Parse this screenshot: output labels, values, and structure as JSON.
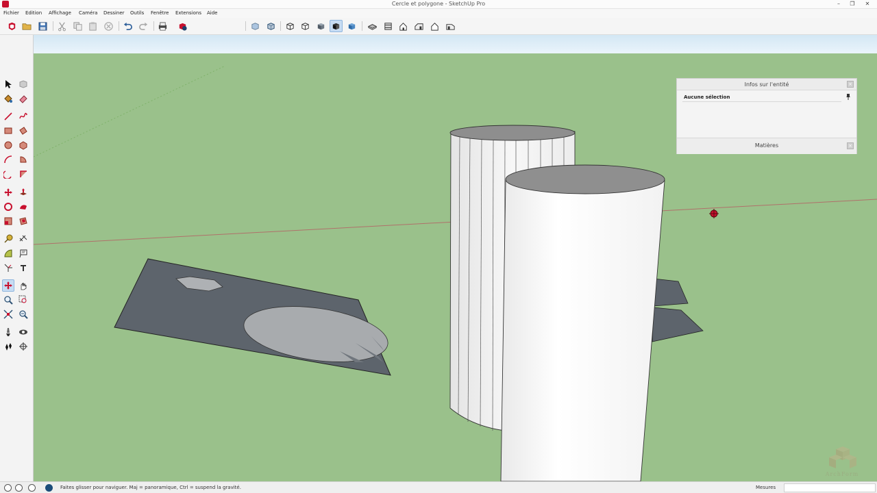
{
  "window": {
    "title": "Cercle et polygone - SketchUp Pro",
    "controls": [
      "–",
      "❐",
      "✕"
    ]
  },
  "menu": [
    "Fichier",
    "Edition",
    "Affichage",
    "Caméra",
    "Dessiner",
    "Outils",
    "Fenêtre",
    "Extensions",
    "Aide"
  ],
  "toolbar": {
    "buttons": [
      {
        "icon": "sketchup-logo-icon"
      },
      {
        "icon": "open-icon"
      },
      {
        "icon": "save-icon"
      },
      {
        "icon": "cut-icon"
      },
      {
        "icon": "copy-icon"
      },
      {
        "icon": "paste-icon"
      },
      {
        "icon": "erase-icon"
      },
      {
        "icon": "undo-icon"
      },
      {
        "icon": "redo-icon"
      },
      {
        "icon": "print-icon"
      },
      {
        "icon": "model-info-icon"
      },
      {
        "icon": "xray-icon"
      },
      {
        "icon": "back-edges-icon"
      },
      {
        "icon": "wireframe-icon"
      },
      {
        "icon": "hidden-line-icon"
      },
      {
        "icon": "shaded-icon"
      },
      {
        "icon": "shaded-textures-icon",
        "active": true
      },
      {
        "icon": "monochrome-icon"
      },
      {
        "icon": "iso-view-icon"
      },
      {
        "icon": "top-view-icon"
      },
      {
        "icon": "front-view-icon"
      },
      {
        "icon": "right-view-icon"
      },
      {
        "icon": "back-view-icon"
      },
      {
        "icon": "left-view-icon"
      }
    ]
  },
  "palette": {
    "tools": [
      "select-icon",
      "component-icon",
      "paint-bucket-icon",
      "eraser-icon",
      "line-icon",
      "freehand-icon",
      "rectangle-icon",
      "rotated-rectangle-icon",
      "circle-icon",
      "polygon-icon",
      "arc-icon",
      "pie-icon",
      "two-point-arc-icon",
      "three-point-arc-icon",
      "move-icon",
      "push-pull-icon",
      "rotate-icon",
      "follow-me-icon",
      "scale-icon",
      "offset-icon",
      "tape-measure-icon",
      "dimension-icon",
      "protractor-icon",
      "text-icon",
      "axes-icon",
      "3d-text-icon",
      "orbit-icon",
      "pan-icon",
      "zoom-icon",
      "zoom-window-icon",
      "zoom-extents-icon",
      "previous-icon",
      "position-camera-icon",
      "look-around-icon",
      "walk-icon",
      "section-plane-icon"
    ],
    "active_tool": "orbit-icon"
  },
  "entity_panel": {
    "title": "Infos sur l'entité",
    "selection": "Aucune sélection",
    "materials_tab": "Matières"
  },
  "status": {
    "hint": "Faites glisser pour naviguer. Maj = panoramique, Ctrl = suspend la gravité.",
    "measure_label": "Mesures",
    "measure_value": ""
  },
  "watermark": {
    "text": "ArchForm"
  },
  "colors": {
    "sky": "#d6e9f5",
    "ground": "#9ac18b",
    "face_dark": "#5d646c",
    "face_light": "#ffffff",
    "selection_blue": "#c7dcf3"
  }
}
